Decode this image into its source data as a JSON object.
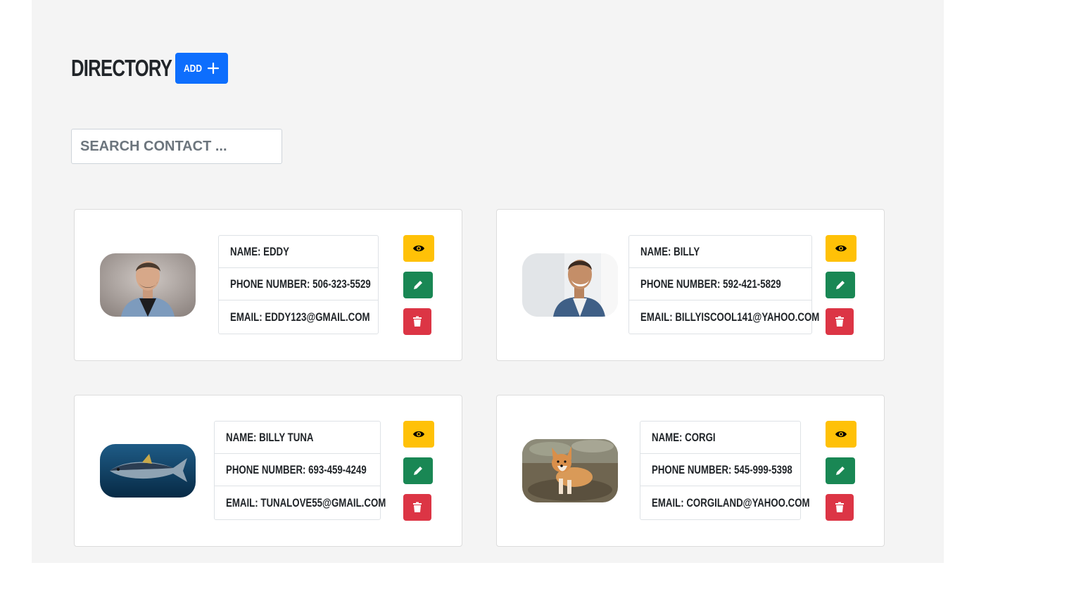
{
  "header": {
    "title": "Directory",
    "add_label": "ADD"
  },
  "search": {
    "placeholder": "SEARCH CONTACT ..."
  },
  "contacts": [
    {
      "name": "NAME: EDDY",
      "phone": "PHONE NUMBER: 506-323-5529",
      "email": "EMAIL: EDDY123@GMAIL.COM",
      "photo": "man-portrait-photo"
    },
    {
      "name": "NAME: BILLY",
      "phone": "PHONE NUMBER: 592-421-5829",
      "email": "EMAIL: BILLYISCOOL141@YAHOO.COM",
      "photo": "smiling-man-photo"
    },
    {
      "name": "NAME: BILLY TUNA",
      "phone": "PHONE NUMBER: 693-459-4249",
      "email": "EMAIL: TUNALOVE55@GMAIL.COM",
      "photo": "tuna-fish-photo"
    },
    {
      "name": "NAME: CORGI",
      "phone": "PHONE NUMBER: 545-999-5398",
      "email": "EMAIL: CORGILAND@YAHOO.COM",
      "photo": "corgi-dog-photo"
    }
  ],
  "icons": {
    "view": "eye-icon",
    "edit": "pencil-icon",
    "delete": "trash-icon",
    "add": "plus-icon"
  },
  "colors": {
    "primary": "#0d6efd",
    "warning": "#ffc107",
    "success": "#198754",
    "danger": "#dc3545"
  }
}
